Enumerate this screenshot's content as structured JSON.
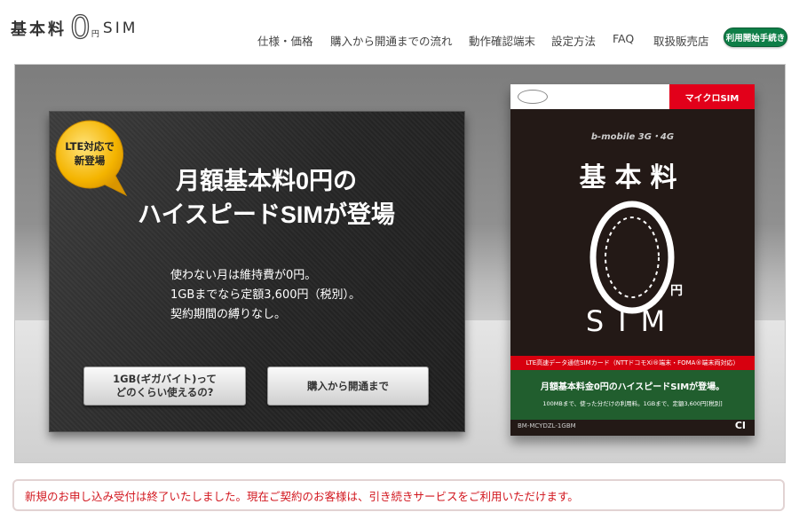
{
  "header": {
    "logo": {
      "kanji": "基本料",
      "zero": "0",
      "en": "円",
      "sim": "SIM"
    },
    "nav": [
      {
        "label": "仕様・価格"
      },
      {
        "label": "購入から開通までの流れ"
      },
      {
        "label": "動作確認端末"
      },
      {
        "label": "設定方法"
      },
      {
        "label": "FAQ"
      },
      {
        "label": "取扱販売店"
      }
    ],
    "cta": {
      "label": "利用開始手続き",
      "color": "#0e7e47"
    }
  },
  "hero": {
    "badge": {
      "line1": "LTE対応で",
      "line2": "新登場",
      "color": "#f4b400"
    },
    "headline": {
      "line1": "月額基本料0円の",
      "line2": "ハイスピードSIMが登場"
    },
    "body": [
      "使わない月は維持費が0円。",
      "1GBまでなら定額3,600円（税別）。",
      "契約期間の縛りなし。"
    ],
    "buttons": {
      "gb_line1": "1GB(ギガバイト)って",
      "gb_line2": "どのくらい使えるの?",
      "flow": "購入から開通まで"
    }
  },
  "package": {
    "micro": "マイクロSIM",
    "brand": "b-mobile 3G・4G",
    "kanji": "基本料",
    "zero": "0",
    "en": "円",
    "sim": "SIM",
    "red_band": "LTE高速データ通信SIMカード（NTTドコモXi®端末・FOMA®端末両対応）",
    "green_title": "月額基本料金0円のハイスピードSIMが登場。",
    "green_note": "100MBまで、使った分だけの利用料。1GBまで、定額3,600円[税別]",
    "code": "BM-MCYDZL-1GBM",
    "maker": "CI",
    "colors": {
      "red": "#e2001a",
      "green": "#215e2e",
      "body": "#231916"
    }
  },
  "notice": {
    "text": "新規のお申し込み受付は終了いたしました。現在ご契約のお客様は、引き続きサービスをご利用いただけます。",
    "color": "#d2171f"
  }
}
